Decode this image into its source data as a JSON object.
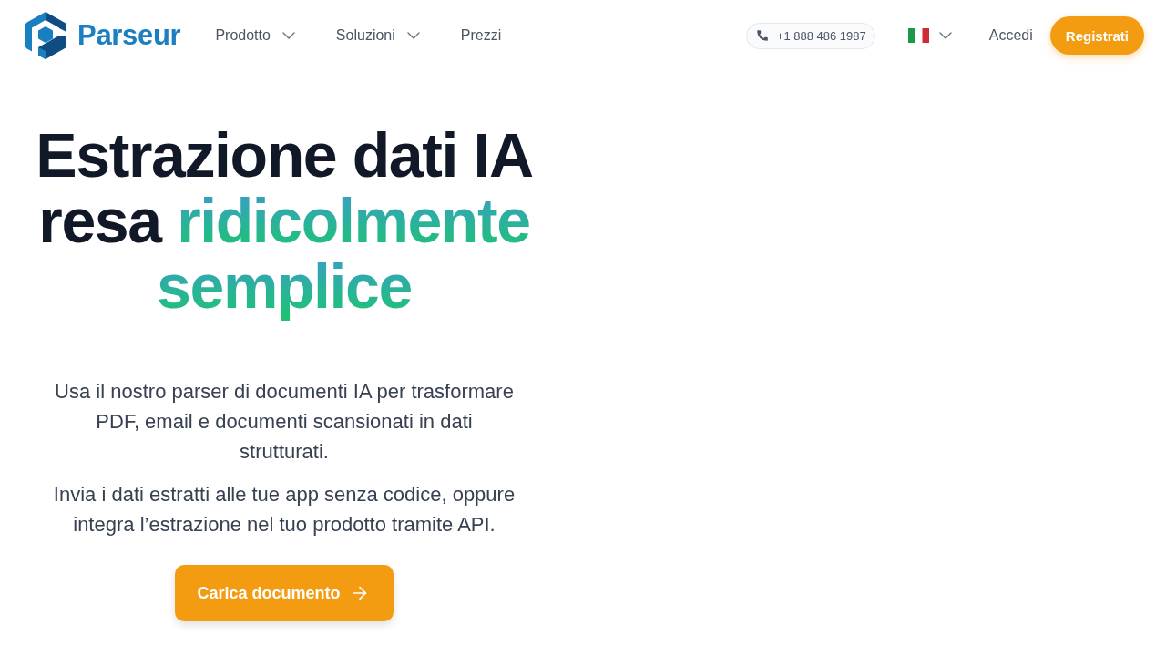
{
  "header": {
    "logo": {
      "text": "Parseur"
    },
    "nav": [
      {
        "label": "Prodotto",
        "has_dropdown": true
      },
      {
        "label": "Soluzioni",
        "has_dropdown": true
      },
      {
        "label": "Prezzi",
        "has_dropdown": false
      }
    ],
    "phone": "+1 888 486 1987",
    "login": "Accedi",
    "signup": "Registrati"
  },
  "hero": {
    "headline": {
      "text": "Estrazione dati IA resa",
      "highlight": "ridicolmente semplice"
    },
    "paragraphs": [
      "Usa il nostro parser di documenti IA per trasformare PDF, email e documenti scansionati in dati strutturati.",
      "Invia i dati estratti alle tue app senza codice, oppure integra l’estrazione nel tuo prodotto tramite API."
    ],
    "cta": "Carica documento"
  }
}
